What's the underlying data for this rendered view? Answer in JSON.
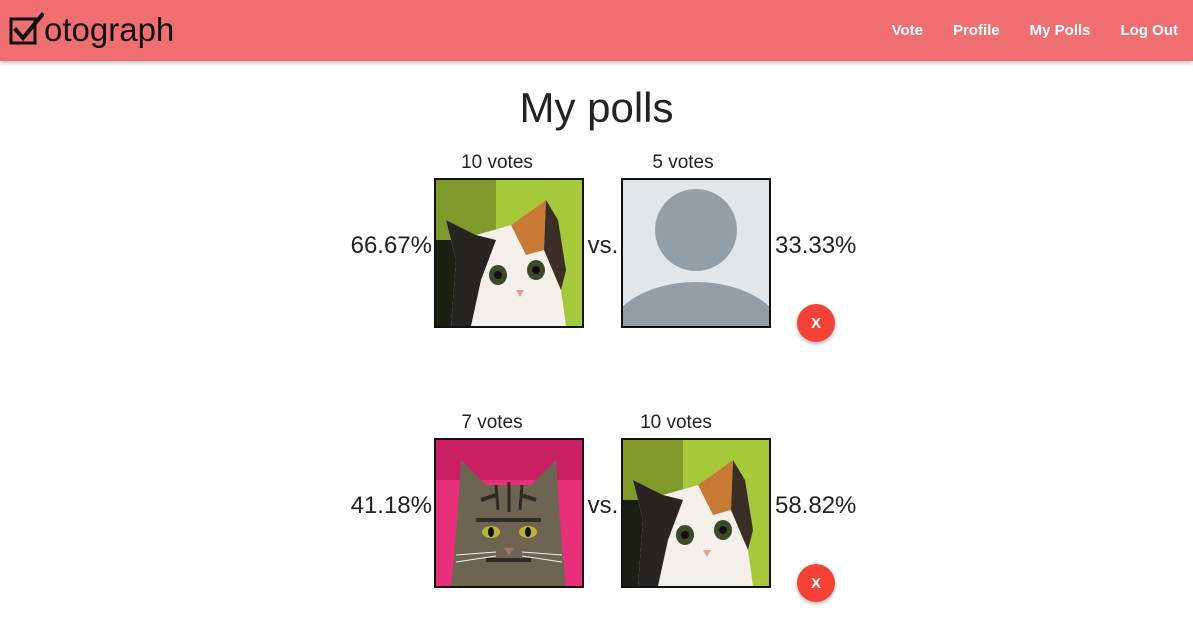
{
  "navbar": {
    "brand_text": "otograph",
    "brand_icon": "checkbox-checked-icon",
    "background": "#ef6e72",
    "links": [
      {
        "label": "Vote"
      },
      {
        "label": "Profile"
      },
      {
        "label": "My Polls"
      },
      {
        "label": "Log Out"
      }
    ]
  },
  "page": {
    "title": "My polls"
  },
  "polls": [
    {
      "left": {
        "votes": "10 votes",
        "percent": "66.67%",
        "image": "calico-kitten-photo"
      },
      "vs": "vs.",
      "right": {
        "votes": "5 votes",
        "percent": "33.33%",
        "image": "default-avatar-placeholder"
      },
      "delete_label": "X"
    },
    {
      "left": {
        "votes": "7 votes",
        "percent": "41.18%",
        "image": "tabby-cat-photo"
      },
      "vs": "vs.",
      "right": {
        "votes": "10 votes",
        "percent": "58.82%",
        "image": "calico-kitten-photo"
      },
      "delete_label": "X"
    }
  ],
  "colors": {
    "delete_button": "#f44336",
    "nav_text": "#ffffff"
  }
}
